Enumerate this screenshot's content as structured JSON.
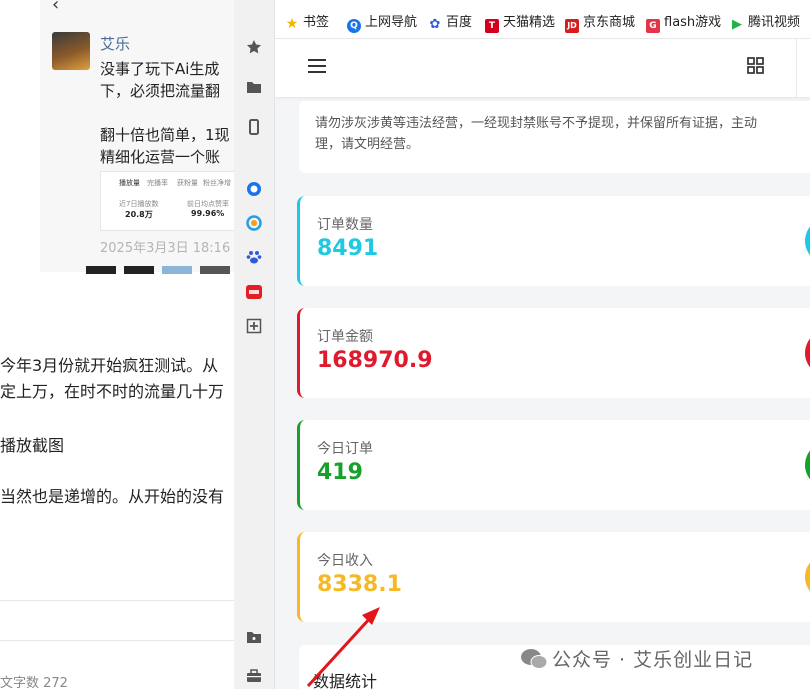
{
  "article": {
    "author": "艾乐",
    "post_lines": [
      "没事了玩下Ai生成",
      "下，必须把流量翻",
      "",
      "翻十倍也简单，1现",
      "精细化运营一个账"
    ],
    "thumb_labels": [
      "播放量",
      "完播率",
      "获粉量",
      "粉丝净增",
      "近7日播放数",
      "20.8万",
      "前日均点赞率",
      "99.96%"
    ],
    "post_date": "2025年3月3日 18:16",
    "body_lines": [
      "今年3月份就开始疯狂测试。从",
      "定上万，在时不时的流量几十万",
      "播放截图",
      "当然也是递增的。从开始的没有"
    ],
    "word_count": "文字数  272"
  },
  "bookmarks": [
    {
      "icon": "star-icon",
      "label": "书签",
      "color": "#f5b400"
    },
    {
      "icon": "shangwang-icon",
      "label": "上网导航",
      "color": "#1a73e8"
    },
    {
      "icon": "baidu-paw-icon",
      "label": "百度",
      "color": "#2f5bd8"
    },
    {
      "icon": "tmall-icon",
      "label": "天猫精选",
      "color": "#d4001b"
    },
    {
      "icon": "jd-icon",
      "label": "京东商城",
      "color": "#d71e1e"
    },
    {
      "icon": "flash-game-icon",
      "label": "flash游戏",
      "color": "#e3354a"
    },
    {
      "icon": "tencent-video-icon",
      "label": "腾讯视频",
      "color": "#21b24c"
    }
  ],
  "app": {
    "notice": [
      "请勿涉灰涉黄等违法经营，一经现封禁账号不予提现，并保留所有证据，主动",
      "理，请文明经营。"
    ],
    "cards": [
      {
        "label": "订单数量",
        "value": "8491",
        "color": "#1fc8e3"
      },
      {
        "label": "订单金额",
        "value": "168970.9",
        "color": "#e0192d"
      },
      {
        "label": "今日订单",
        "value": "419",
        "color": "#17a02a"
      },
      {
        "label": "今日收入",
        "value": "8338.1",
        "color": "#f7b824"
      }
    ],
    "stats_title": "数据统计"
  },
  "watermark": "公众号 · 艾乐创业日记"
}
